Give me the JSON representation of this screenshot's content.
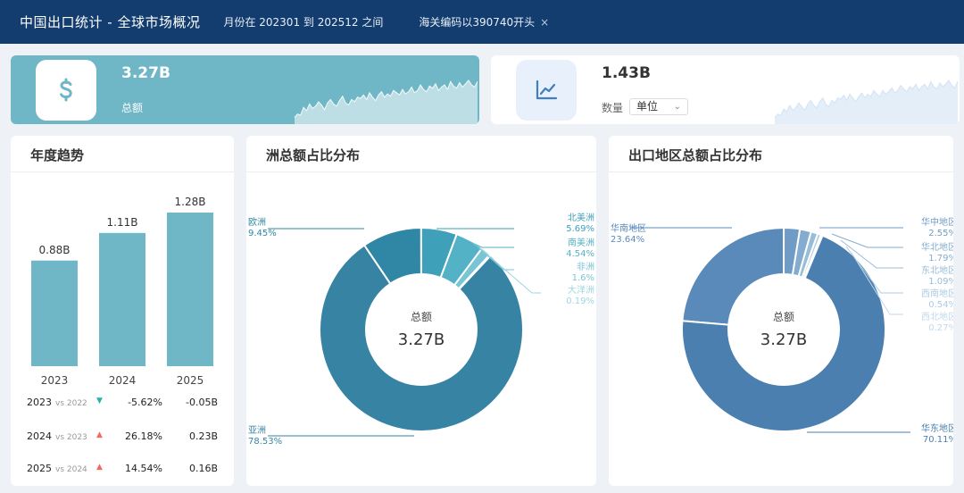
{
  "header": {
    "title": "中国出口统计 - 全球市场概况",
    "date_filter": "月份在 202301 到 202512 之间",
    "code_filter": "海关编码以390740开头",
    "close_glyph": "×"
  },
  "kpis": [
    {
      "value": "3.27B",
      "label": "总额",
      "icon": "dollar-icon",
      "sparkline": [
        6,
        9,
        8,
        15,
        12,
        18,
        14,
        16,
        20,
        17,
        13,
        19,
        22,
        18,
        16,
        21,
        25,
        19,
        17,
        22,
        20,
        24,
        23,
        26,
        22,
        28,
        24,
        21,
        26,
        29,
        24,
        27,
        25,
        30,
        28,
        26,
        31,
        27,
        29,
        33,
        28,
        30,
        35,
        31,
        29,
        34,
        32,
        36,
        30,
        33,
        35,
        31,
        38,
        34,
        32,
        37,
        33,
        36,
        39,
        35,
        33,
        38
      ]
    },
    {
      "value": "1.43B",
      "label": "数量",
      "select_value": "单位",
      "icon": "trend-line-icon",
      "sparkline": [
        5,
        8,
        7,
        12,
        10,
        15,
        11,
        13,
        17,
        14,
        11,
        16,
        19,
        15,
        13,
        18,
        21,
        16,
        14,
        19,
        17,
        21,
        20,
        23,
        19,
        24,
        21,
        18,
        22,
        25,
        21,
        24,
        22,
        27,
        24,
        22,
        27,
        24,
        26,
        29,
        25,
        27,
        31,
        28,
        26,
        30,
        28,
        32,
        27,
        30,
        32,
        28,
        34,
        30,
        28,
        33,
        30,
        32,
        35,
        31,
        29,
        34
      ]
    }
  ],
  "trend": {
    "title": "年度趋势",
    "chart_data": {
      "type": "bar",
      "categories": [
        "2023",
        "2024",
        "2025"
      ],
      "values": [
        0.88,
        1.11,
        1.28
      ],
      "value_labels": [
        "0.88B",
        "1.11B",
        "1.28B"
      ],
      "color": "#6fb6c6"
    },
    "yoy": [
      {
        "year": "2023",
        "vs": "vs 2022",
        "direction": "down",
        "pct": "-5.62%",
        "abs": "-0.05B"
      },
      {
        "year": "2024",
        "vs": "vs 2023",
        "direction": "up",
        "pct": "26.18%",
        "abs": "0.23B"
      },
      {
        "year": "2025",
        "vs": "vs 2024",
        "direction": "up",
        "pct": "14.54%",
        "abs": "0.16B"
      }
    ],
    "colors": {
      "up": "#f06b5c",
      "down": "#2ab3a8"
    }
  },
  "continent": {
    "title": "洲总额占比分布",
    "center_label": "总额",
    "center_value": "3.27B",
    "chart_data": {
      "type": "pie",
      "slices": [
        {
          "name": "亚洲",
          "pct_label": "78.53%",
          "value": 78.53,
          "color": "#3783a3"
        },
        {
          "name": "欧洲",
          "pct_label": "9.45%",
          "value": 9.45,
          "color": "#2f87a5"
        },
        {
          "name": "北美洲",
          "pct_label": "5.69%",
          "value": 5.69,
          "color": "#3ea1b9"
        },
        {
          "name": "南美洲",
          "pct_label": "4.54%",
          "value": 4.54,
          "color": "#54b2c6"
        },
        {
          "name": "非洲",
          "pct_label": "1.6%",
          "value": 1.6,
          "color": "#78c5d4"
        },
        {
          "name": "大洋洲",
          "pct_label": "0.19%",
          "value": 0.19,
          "color": "#9fd6e0"
        }
      ]
    }
  },
  "region": {
    "title": "出口地区总额占比分布",
    "center_label": "总额",
    "center_value": "3.27B",
    "chart_data": {
      "type": "pie",
      "slices": [
        {
          "name": "华东地区",
          "pct_label": "70.11%",
          "value": 70.11,
          "color": "#4a7fb0"
        },
        {
          "name": "华南地区",
          "pct_label": "23.64%",
          "value": 23.64,
          "color": "#5a8ab9"
        },
        {
          "name": "华中地区",
          "pct_label": "2.55%",
          "value": 2.55,
          "color": "#6f9cc6"
        },
        {
          "name": "华北地区",
          "pct_label": "1.79%",
          "value": 1.79,
          "color": "#84acd0"
        },
        {
          "name": "东北地区",
          "pct_label": "1.09%",
          "value": 1.09,
          "color": "#99bcd9"
        },
        {
          "name": "西南地区",
          "pct_label": "0.54%",
          "value": 0.54,
          "color": "#adcbe2"
        },
        {
          "name": "西北地区",
          "pct_label": "0.27%",
          "value": 0.27,
          "color": "#c2d9ea"
        }
      ]
    }
  }
}
